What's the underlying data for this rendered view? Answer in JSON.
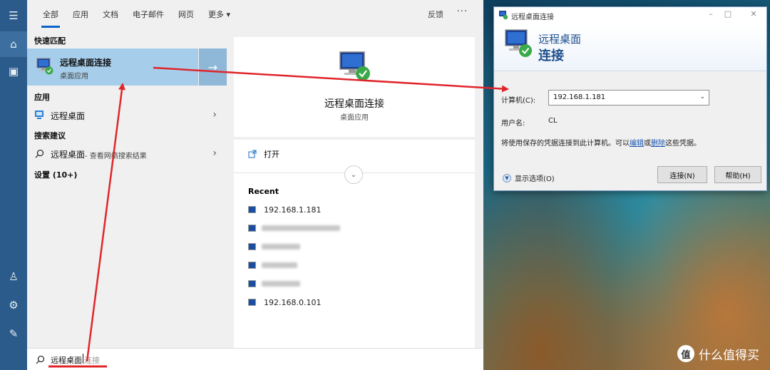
{
  "rail": {
    "items": [
      {
        "icon": "hamburger-menu-icon",
        "glyph": "☰"
      },
      {
        "icon": "home-icon",
        "glyph": "⌂"
      },
      {
        "icon": "document-icon",
        "glyph": "▣"
      },
      {
        "icon": "user-icon",
        "glyph": "♙"
      },
      {
        "icon": "settings-gear-icon",
        "glyph": "⚙"
      },
      {
        "icon": "feedback-person-icon",
        "glyph": "✎"
      }
    ]
  },
  "tabs": {
    "all": "全部",
    "apps": "应用",
    "docs": "文档",
    "email": "电子邮件",
    "web": "网页",
    "more": "更多 ▾",
    "feedback": "反馈",
    "more_dots": "···"
  },
  "results": {
    "best_match_header": "快速匹配",
    "best_match_title": "远程桌面连接",
    "best_match_sub": "桌面应用",
    "apps_header": "应用",
    "app_item": "远程桌面",
    "suggest_header": "搜索建议",
    "suggest_query": "远程桌面",
    "suggest_hint": " - 查看网络搜索结果",
    "settings_header": "设置 (10+)"
  },
  "detail": {
    "title": "远程桌面连接",
    "sub": "桌面应用",
    "open": "打开",
    "recent_header": "Recent",
    "recent": [
      "192.168.1.181",
      "",
      "",
      "",
      "",
      "192.168.0.101"
    ]
  },
  "searchbar": {
    "typed": "远程桌面",
    "suggestion": "连接"
  },
  "dialog": {
    "window_title": "远程桌面连接",
    "header_line1": "远程桌面",
    "header_line2": "连接",
    "computer_label": "计算机(C):",
    "computer_value": "192.168.1.181",
    "username_label": "用户名:",
    "username_value": "CL",
    "note_prefix": "将使用保存的凭据连接到此计算机。可以",
    "note_edit": "编辑",
    "note_or": "或",
    "note_delete": "删除",
    "note_suffix": "这些凭据。",
    "show_options": "显示选项(O)",
    "connect_button": "连接(N)",
    "help_button": "帮助(H)"
  },
  "watermark": {
    "badge": "值",
    "text": "什么值得买"
  },
  "colors": {
    "accent": "#0a63c9",
    "rail": "#2b5b8a",
    "selected": "#a6cdea",
    "arrow_red": "#e0262b"
  }
}
